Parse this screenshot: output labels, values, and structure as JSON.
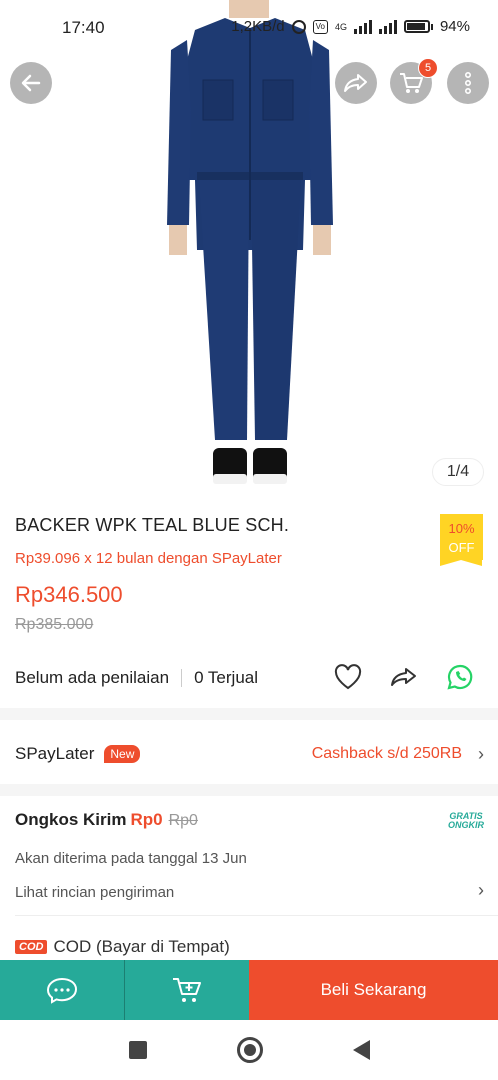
{
  "status_bar": {
    "time": "17:40",
    "network_speed": "1,2KB/d",
    "network_type": "4G",
    "battery": "94%"
  },
  "header": {
    "back_icon": "arrow-left-icon",
    "share_icon": "share-icon",
    "cart_icon": "cart-icon",
    "cart_count": "5",
    "more_icon": "more-vertical-icon"
  },
  "gallery": {
    "counter": "1/4"
  },
  "product": {
    "title": "BACKER WPK TEAL BLUE SCH.",
    "discount_percent": "10%",
    "discount_label": "OFF",
    "installment": "Rp39.096 x 12 bulan dengan SPayLater",
    "price": "Rp346.500",
    "original_price": "Rp385.000",
    "rating_text": "Belum ada penilaian",
    "sold_text": "0 Terjual"
  },
  "spaylater": {
    "label": "SPayLater",
    "badge": "New",
    "cashback": "Cashback s/d 250RB"
  },
  "shipping": {
    "label": "Ongkos Kirim",
    "cost": "Rp0",
    "original_cost": "Rp0",
    "gratis_line1": "GRATIS",
    "gratis_line2": "ONGKIR",
    "delivery_date": "Akan diterima pada tanggal 13 Jun",
    "detail_link": "Lihat rincian pengiriman"
  },
  "cod": {
    "logo": "COD",
    "label": "COD (Bayar di Tempat)"
  },
  "bottom": {
    "buy_now": "Beli Sekarang"
  },
  "colors": {
    "accent": "#ee4d2d",
    "teal": "#26aa99",
    "badge_yellow": "#ffd424"
  }
}
